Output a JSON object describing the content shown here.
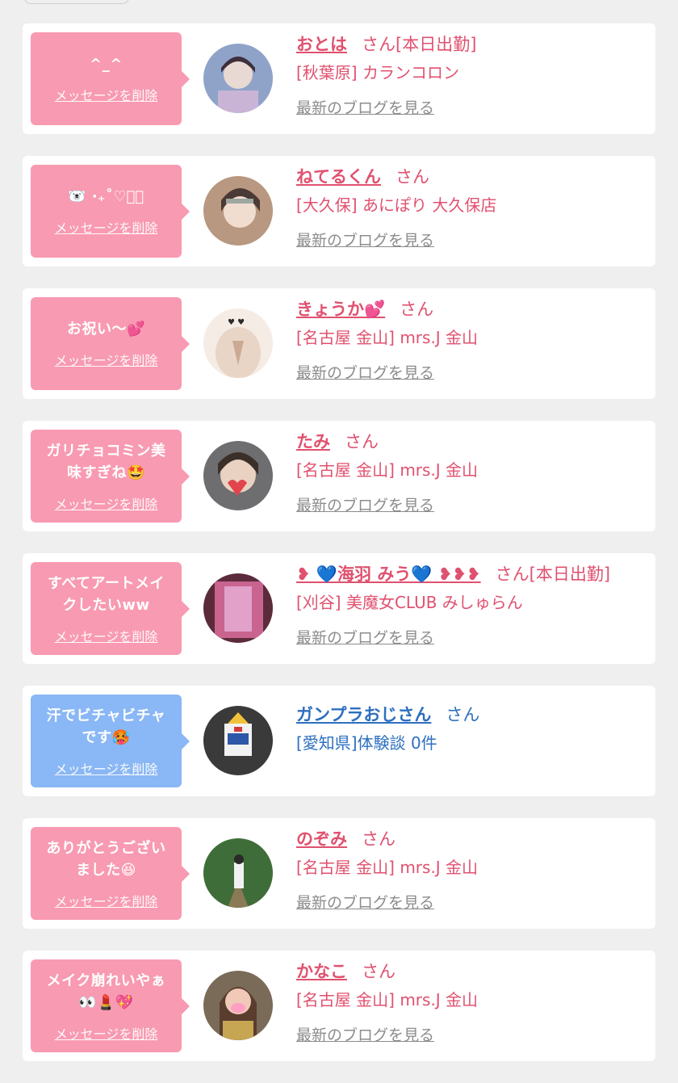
{
  "cards": [
    {
      "bubble_color": "#f89ab1",
      "message_lines": [
        "^_^"
      ],
      "delete_label": "メッセージを削除",
      "name": "おとは",
      "suffix": "さん[本日出勤]",
      "shop": "[秋葉原] カランコロン",
      "blog_label": "最新のブログを見る",
      "avatar_colors": [
        "#8fa3c9",
        "#e8d9d2",
        "#3d2f3b"
      ]
    },
    {
      "bubble_color": "#f89ab1",
      "message_lines": [
        "🐻‍❄️ ‧₊˚♡ྀི"
      ],
      "delete_label": "メッセージを削除",
      "name": "ねてるくん",
      "suffix": "さん",
      "shop": "[大久保] あにぽり 大久保店",
      "blog_label": "最新のブログを見る",
      "avatar_colors": [
        "#b89880",
        "#f1ddd0",
        "#4a3a35"
      ]
    },
    {
      "bubble_color": "#f89ab1",
      "message_lines": [
        "お祝い〜💕"
      ],
      "delete_label": "メッセージを削除",
      "name": "きょうか💕",
      "suffix": "さん",
      "shop": "[名古屋 金山] mrs.J 金山",
      "blog_label": "最新のブログを見る",
      "avatar_colors": [
        "#f4ece5",
        "#e9d5c6",
        "#2a2a2a"
      ]
    },
    {
      "bubble_color": "#f89ab1",
      "message_lines": [
        "ガリチョコミン美",
        "味すぎね🤩"
      ],
      "delete_label": "メッセージを削除",
      "name": "たみ",
      "suffix": "さん",
      "shop": "[名古屋 金山] mrs.J 金山",
      "blog_label": "最新のブログを見る",
      "avatar_colors": [
        "#6e6e70",
        "#e9d2c2",
        "#e2454b"
      ]
    },
    {
      "bubble_color": "#f89ab1",
      "message_lines": [
        "すべてアートメイ",
        "クしたいww"
      ],
      "delete_label": "メッセージを削除",
      "name": "❥ 💙海羽 みう💙 ❥❥❥",
      "suffix": "さん[本日出勤]",
      "shop": "[刈谷] 美魔女CLUB みしゅらん",
      "blog_label": "最新のブログを見る",
      "avatar_colors": [
        "#c9648f",
        "#e7b0d6",
        "#5b2b3c"
      ]
    },
    {
      "bubble_color": "#8ab7f5",
      "message_lines": [
        "汗でビチャビチャ",
        "です🥵"
      ],
      "delete_label": "メッセージを削除",
      "name": "ガンプラおじさん",
      "suffix": "さん",
      "shop": "[愛知県]体験談 0件",
      "blog_label": "",
      "avatar_colors": [
        "#3a3a3a",
        "#f2f2f2",
        "#2f57a8"
      ]
    },
    {
      "bubble_color": "#f89ab1",
      "message_lines": [
        "ありがとうござい",
        "ました😆"
      ],
      "delete_label": "メッセージを削除",
      "name": "のぞみ",
      "suffix": "さん",
      "shop": "[名古屋 金山] mrs.J 金山",
      "blog_label": "最新のブログを見る",
      "avatar_colors": [
        "#3f6d39",
        "#f1f1f1",
        "#8a7a55"
      ]
    },
    {
      "bubble_color": "#f89ab1",
      "message_lines": [
        "メイク崩れいやぁ",
        "👀💄💖"
      ],
      "delete_label": "メッセージを削除",
      "name": "かなこ",
      "suffix": "さん",
      "shop": "[名古屋 金山] mrs.J 金山",
      "blog_label": "最新のブログを見る",
      "avatar_colors": [
        "#7a6a58",
        "#f0c9b8",
        "#ff9fc4"
      ]
    }
  ]
}
